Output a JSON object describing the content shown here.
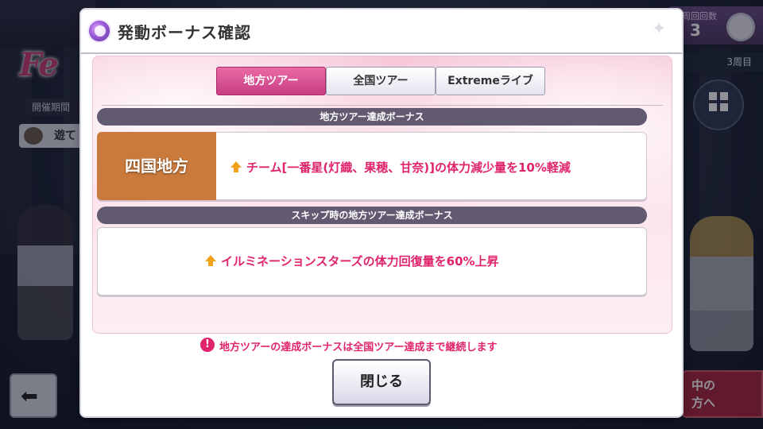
{
  "background": {
    "logo": "Fe",
    "period_label": "開催期間",
    "play_label": "遊て",
    "counter_label": "周回回数",
    "counter_value": "3",
    "round_label": "3周目",
    "menu_label": "メニュー",
    "tour_button": "中の\n方へ"
  },
  "dialog": {
    "title": "発動ボーナス確認",
    "tabs": [
      {
        "label": "地方ツアー",
        "active": true
      },
      {
        "label": "全国ツアー",
        "active": false
      },
      {
        "label": "Extremeライブ",
        "active": false
      }
    ],
    "section1": {
      "header": "地方ツアー達成ボーナス",
      "region": "四国地方",
      "bonus": "チーム[一番星(灯織、果穂、甘奈)]の体力減少量を10%軽減"
    },
    "section2": {
      "header": "スキップ時の地方ツアー達成ボーナス",
      "bonus": "イルミネーションスターズの体力回復量を60%上昇"
    },
    "note": "地方ツアーの達成ボーナスは全国ツアー達成まで継続します",
    "close_label": "閉じる"
  },
  "colors": {
    "accent_pink": "#e0246c",
    "tab_active": "#c83e84",
    "region_tag": "#c97a3c",
    "section_header": "#625a70"
  },
  "icons": [
    "sparkle-icon",
    "up-arrow-icon",
    "alert-icon",
    "back-arrow-icon",
    "menu-grid-icon"
  ]
}
